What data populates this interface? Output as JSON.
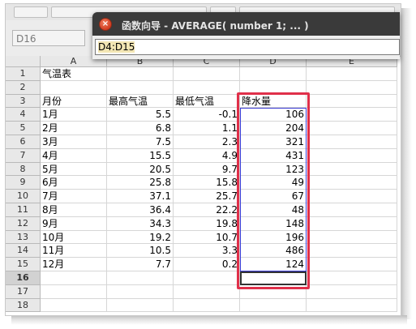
{
  "namebox": {
    "value": "D16"
  },
  "dialog": {
    "title": "函数向导  - AVERAGE( number 1; ... )",
    "reference": "D4:D15"
  },
  "columns": [
    "A",
    "B",
    "C",
    "D",
    "E"
  ],
  "rows": [
    {
      "n": "1",
      "a": "气温表",
      "b": "",
      "c": "",
      "d": ""
    },
    {
      "n": "2",
      "a": "",
      "b": "",
      "c": "",
      "d": ""
    },
    {
      "n": "3",
      "a": "月份",
      "b": "最高气温",
      "c": "最低气温",
      "d": "降水量"
    },
    {
      "n": "4",
      "a": "1月",
      "b": "5.5",
      "c": "-0.1",
      "d": "106"
    },
    {
      "n": "5",
      "a": "2月",
      "b": "6.8",
      "c": "1.1",
      "d": "204"
    },
    {
      "n": "6",
      "a": "3月",
      "b": "7.5",
      "c": "2.3",
      "d": "321"
    },
    {
      "n": "7",
      "a": "4月",
      "b": "15.5",
      "c": "4.9",
      "d": "431"
    },
    {
      "n": "8",
      "a": "5月",
      "b": "20.5",
      "c": "9.7",
      "d": "123"
    },
    {
      "n": "9",
      "a": "6月",
      "b": "25.8",
      "c": "15.8",
      "d": "49"
    },
    {
      "n": "10",
      "a": "7月",
      "b": "37.1",
      "c": "25.7",
      "d": "67"
    },
    {
      "n": "11",
      "a": "8月",
      "b": "36.4",
      "c": "22.2",
      "d": "48"
    },
    {
      "n": "12",
      "a": "9月",
      "b": "34.3",
      "c": "19.8",
      "d": "148"
    },
    {
      "n": "13",
      "a": "10月",
      "b": "19.2",
      "c": "10.7",
      "d": "196"
    },
    {
      "n": "14",
      "a": "11月",
      "b": "10.5",
      "c": "3.3",
      "d": "486"
    },
    {
      "n": "15",
      "a": "12月",
      "b": "7.7",
      "c": "0.2",
      "d": "124"
    },
    {
      "n": "16",
      "a": "",
      "b": "",
      "c": "",
      "d": ""
    },
    {
      "n": "17",
      "a": "",
      "b": "",
      "c": "",
      "d": ""
    },
    {
      "n": "18",
      "a": "",
      "b": "",
      "c": "",
      "d": ""
    }
  ],
  "colors": {
    "highlight": "#e0304a",
    "selection": "#3b3bd6"
  }
}
